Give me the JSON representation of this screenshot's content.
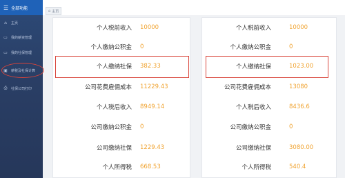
{
  "sidebar": {
    "header_label": "全部功能",
    "items": [
      {
        "label": "主页",
        "icon": "home-icon"
      },
      {
        "label": "我的薪资管理",
        "icon": "document-icon"
      },
      {
        "label": "我的社保管理",
        "icon": "document-icon"
      },
      {
        "label": "薪税及社保计算",
        "icon": "calculator-icon"
      },
      {
        "label": "社保公司打印",
        "icon": "printer-icon"
      }
    ]
  },
  "tab": {
    "label": "主页"
  },
  "left_panel": {
    "rows": [
      {
        "label": "个人税前收入",
        "value": "10000"
      },
      {
        "label": "个人缴纳公积金",
        "value": "0"
      },
      {
        "label": "个人缴纳社保",
        "value": "382.33"
      },
      {
        "label": "公司花费雇佣成本",
        "value": "11229.43"
      },
      {
        "label": "个人税后收入",
        "value": "8949.14"
      },
      {
        "label": "公司缴纳公积金",
        "value": "0"
      },
      {
        "label": "公司缴纳社保",
        "value": "1229.43"
      },
      {
        "label": "个人所得税",
        "value": "668.53"
      }
    ]
  },
  "right_panel": {
    "rows": [
      {
        "label": "个人税前收入",
        "value": "10000"
      },
      {
        "label": "个人缴纳公积金",
        "value": "0"
      },
      {
        "label": "个人缴纳社保",
        "value": "1023.00"
      },
      {
        "label": "公司花费雇佣成本",
        "value": "13080"
      },
      {
        "label": "个人税后收入",
        "value": "8436.6"
      },
      {
        "label": "公司缴纳公积金",
        "value": "0"
      },
      {
        "label": "公司缴纳社保",
        "value": "3080.00"
      },
      {
        "label": "个人所得税",
        "value": "540.4"
      }
    ]
  },
  "colors": {
    "accent": "#1f62b8",
    "value_orange": "#f0a22e",
    "highlight_red": "#d9443a"
  }
}
